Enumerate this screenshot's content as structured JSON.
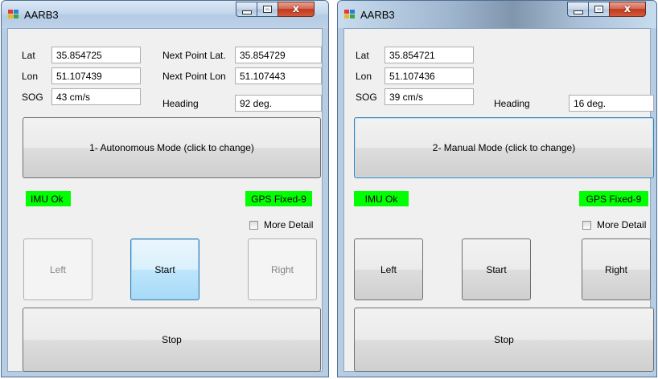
{
  "windows": [
    {
      "title": "AARB3",
      "lat_label": "Lat",
      "lat_value": "35.854725",
      "lon_label": "Lon",
      "lon_value": "51.107439",
      "sog_label": "SOG",
      "sog_value": "43 cm/s",
      "next_lat_label": "Next Point Lat.",
      "next_lat_value": "35.854729",
      "next_lon_label": "Next Point Lon",
      "next_lon_value": "51.107443",
      "heading_label": "Heading",
      "heading_value": "92 deg.",
      "mode_button": "1- Autonomous Mode  (click to change)",
      "imu_status": "IMU Ok",
      "gps_status": "GPS Fixed-9",
      "more_detail": "More Detail",
      "left_button": "Left",
      "start_button": "Start",
      "right_button": "Right",
      "stop_button": "Stop"
    },
    {
      "title": "AARB3",
      "lat_label": "Lat",
      "lat_value": "35.854721",
      "lon_label": "Lon",
      "lon_value": "51.107436",
      "sog_label": "SOG",
      "sog_value": "39 cm/s",
      "heading_label": "Heading",
      "heading_value": "16 deg.",
      "mode_button": "2- Manual Mode  (click to change)",
      "imu_status": "IMU Ok",
      "gps_status": "GPS Fixed-9",
      "more_detail": "More Detail",
      "left_button": "Left",
      "start_button": "Start",
      "right_button": "Right",
      "stop_button": "Stop"
    }
  ],
  "colors": {
    "status_ok": "#00ff00",
    "close_button": "#c0391f",
    "frame": "#b7cde4"
  },
  "icons": {
    "app": "app-icon",
    "minimize": "minimize-icon",
    "maximize": "maximize-icon",
    "close": "close-icon"
  }
}
